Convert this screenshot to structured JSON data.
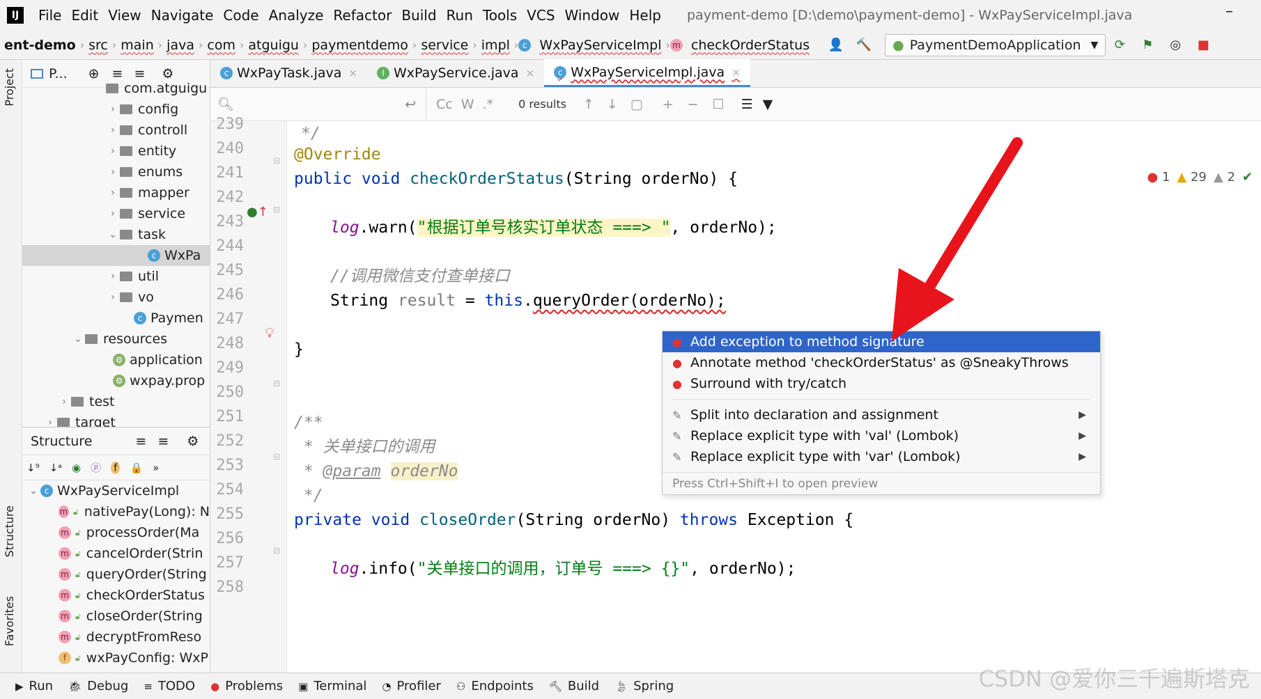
{
  "menubar": {
    "items": [
      "File",
      "Edit",
      "View",
      "Navigate",
      "Code",
      "Analyze",
      "Refactor",
      "Build",
      "Run",
      "Tools",
      "VCS",
      "Window",
      "Help"
    ],
    "title": "payment-demo [D:\\demo\\payment-demo] - WxPayServiceImpl.java"
  },
  "breadcrumbs": [
    "ent-demo",
    "src",
    "main",
    "java",
    "com",
    "atguigu",
    "paymentdemo",
    "service",
    "impl",
    "WxPayServiceImpl",
    "checkOrderStatus"
  ],
  "run_config": "PaymentDemoApplication",
  "project_panel": {
    "title": "P...",
    "items": [
      {
        "label": "com.atguigu",
        "indent": 140,
        "arrow": "",
        "type": "folder"
      },
      {
        "label": "config",
        "indent": 160,
        "arrow": "›",
        "type": "folder"
      },
      {
        "label": "controll",
        "indent": 160,
        "arrow": "›",
        "type": "folder"
      },
      {
        "label": "entity",
        "indent": 160,
        "arrow": "›",
        "type": "folder"
      },
      {
        "label": "enums",
        "indent": 160,
        "arrow": "›",
        "type": "folder"
      },
      {
        "label": "mapper",
        "indent": 160,
        "arrow": "›",
        "type": "folder"
      },
      {
        "label": "service",
        "indent": 160,
        "arrow": "›",
        "type": "folder"
      },
      {
        "label": "task",
        "indent": 160,
        "arrow": "⌄",
        "type": "folder"
      },
      {
        "label": "WxPa",
        "indent": 200,
        "arrow": "",
        "type": "class",
        "selected": true
      },
      {
        "label": "util",
        "indent": 160,
        "arrow": "›",
        "type": "folder"
      },
      {
        "label": "vo",
        "indent": 160,
        "arrow": "›",
        "type": "folder"
      },
      {
        "label": "Paymen",
        "indent": 180,
        "arrow": "",
        "type": "class"
      },
      {
        "label": "resources",
        "indent": 110,
        "arrow": "⌄",
        "type": "folder"
      },
      {
        "label": "application",
        "indent": 150,
        "arrow": "",
        "type": "file"
      },
      {
        "label": "wxpay.prop",
        "indent": 150,
        "arrow": "",
        "type": "file"
      },
      {
        "label": "test",
        "indent": 90,
        "arrow": "›",
        "type": "folder"
      },
      {
        "label": "target",
        "indent": 70,
        "arrow": "›",
        "type": "folder"
      }
    ]
  },
  "structure_panel": {
    "title": "Structure",
    "class_name": "WxPayServiceImpl",
    "members": [
      {
        "badge": "m",
        "label": "nativePay(Long): N"
      },
      {
        "badge": "m",
        "label": "processOrder(Ma"
      },
      {
        "badge": "m",
        "label": "cancelOrder(Strin"
      },
      {
        "badge": "m",
        "label": "queryOrder(String"
      },
      {
        "badge": "m",
        "label": "checkOrderStatus"
      },
      {
        "badge": "m",
        "label": "closeOrder(String"
      },
      {
        "badge": "m",
        "label": "decryptFromReso"
      },
      {
        "badge": "f",
        "label": "wxPayConfig: WxP"
      }
    ]
  },
  "editor": {
    "tabs": [
      {
        "label": "WxPayTask.java",
        "color": "#4a9fd8",
        "letter": "c"
      },
      {
        "label": "WxPayService.java",
        "color": "#5fb05f",
        "letter": "I"
      },
      {
        "label": "WxPayServiceImpl.java",
        "color": "#4a9fd8",
        "letter": "c",
        "active": true
      }
    ],
    "find_results": "0 results",
    "line_numbers": [
      "239",
      "240",
      "241",
      "242",
      "243",
      "244",
      "245",
      "246",
      "247",
      "248",
      "249",
      "250",
      "251",
      "252",
      "253",
      "254",
      "255",
      "256",
      "257",
      "258"
    ],
    "inspections": {
      "errors": "1",
      "warnings": "29",
      "weak": "2"
    }
  },
  "code": {
    "l239": "*/",
    "l240": "@Override",
    "l241a": "public void ",
    "l241b": "checkOrderStatus",
    "l241c": "(String orderNo) {",
    "l243a": "log",
    "l243b": ".warn(",
    "l243c": "\"根据订单号核实订单状态 ===> \"",
    "l243d": ", orderNo);",
    "l245": "//调用微信支付查单接口",
    "l246a": "String ",
    "l246b": "result",
    "l246c": " = ",
    "l246d": "this",
    "l246e": ".",
    "l246f": "queryOrder",
    "l246g": "(orderNo);",
    "l248": "}",
    "l251": "/**",
    "l252": " * 关单接口的调用",
    "l253a": " * ",
    "l253b": "@param",
    "l253c": " ",
    "l253d": "orderNo",
    "l254": " */",
    "l255a": "private void ",
    "l255b": "closeOrder",
    "l255c": "(String orderNo) ",
    "l255d": "throws",
    "l255e": " Exception {",
    "l257a": "log",
    "l257b": ".info(",
    "l257c": "\"关单接口的调用，订单号 ===> {}\"",
    "l257d": ", orderNo);"
  },
  "popup": {
    "items": [
      {
        "label": "Add exception to method signature",
        "icon": "error",
        "selected": true
      },
      {
        "label": "Annotate method 'checkOrderStatus' as @SneakyThrows",
        "icon": "error"
      },
      {
        "label": "Surround with try/catch",
        "icon": "error"
      }
    ],
    "items2": [
      {
        "label": "Split into declaration and assignment",
        "icon": "intention",
        "submenu": true
      },
      {
        "label": "Replace explicit type with 'val' (Lombok)",
        "icon": "intention",
        "submenu": true
      },
      {
        "label": "Replace explicit type with 'var' (Lombok)",
        "icon": "intention",
        "submenu": true
      }
    ],
    "footer": "Press Ctrl+Shift+I to open preview"
  },
  "statusbar": [
    "Run",
    "Debug",
    "TODO",
    "Problems",
    "Terminal",
    "Profiler",
    "Endpoints",
    "Build",
    "Spring"
  ],
  "side_tabs": {
    "project": "Project",
    "structure": "Structure",
    "favorites": "Favorites"
  },
  "watermark": "CSDN @爱你三千遍斯塔克",
  "colors": {
    "accent": "#2f65ca",
    "error": "#d33",
    "arrow": "#e8141c"
  }
}
